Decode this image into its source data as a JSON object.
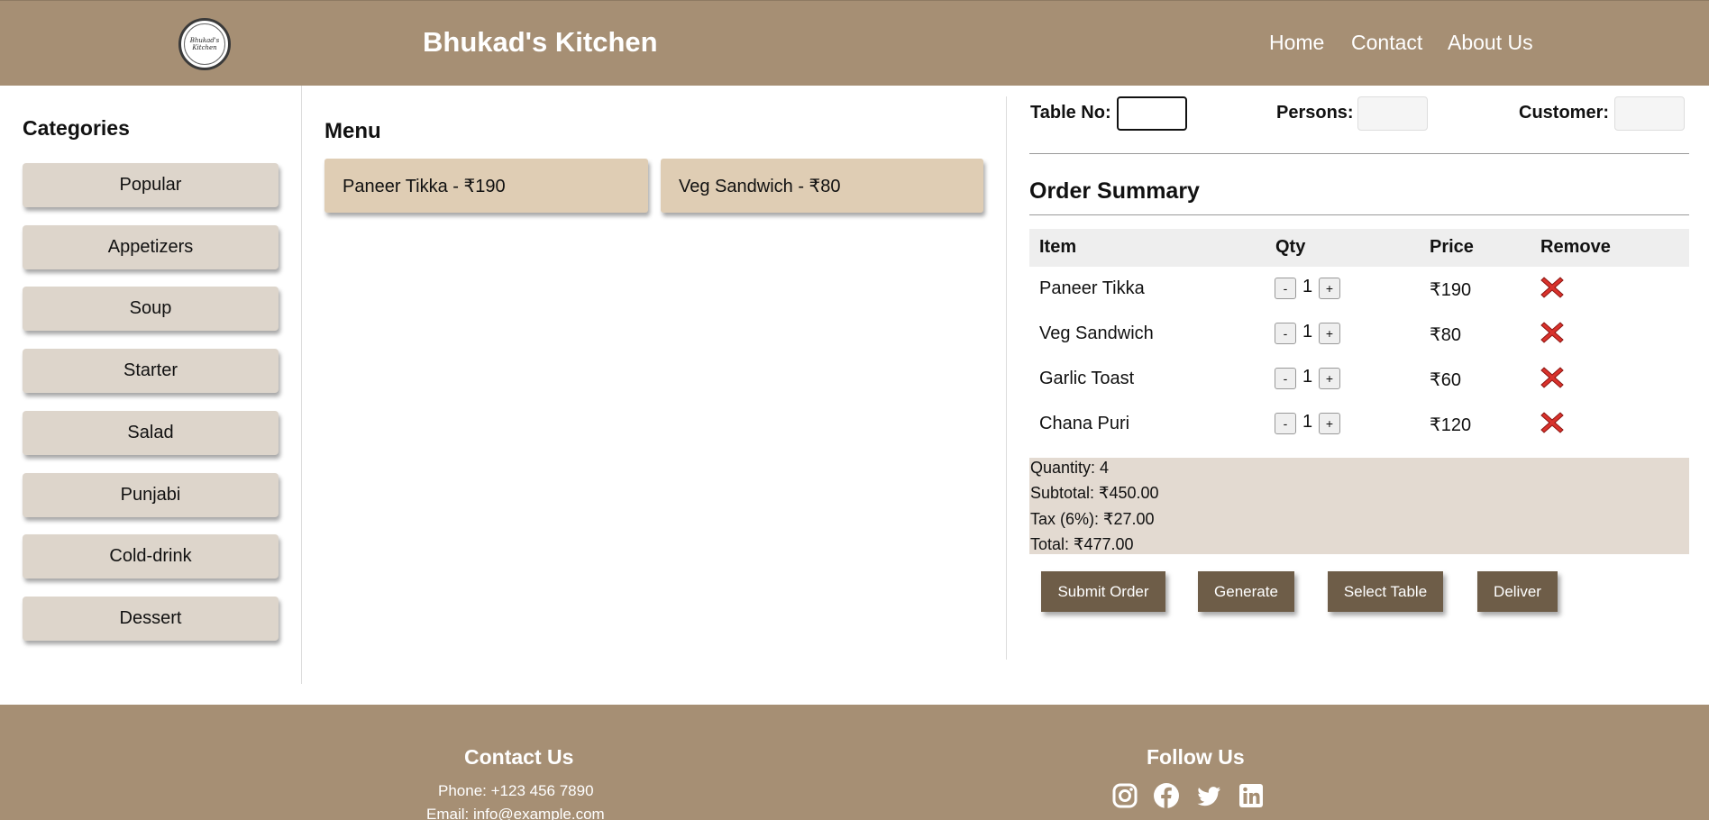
{
  "header": {
    "brand": "Bhukad's Kitchen",
    "logo_text": "Bhukad's Kitchen",
    "nav": [
      "Home",
      "Contact",
      "About Us"
    ]
  },
  "sidebar": {
    "title": "Categories",
    "categories": [
      "Popular",
      "Appetizers",
      "Soup",
      "Starter",
      "Salad",
      "Punjabi",
      "Cold-drink",
      "Dessert"
    ]
  },
  "menu": {
    "title": "Menu",
    "items": [
      "Paneer Tikka - ₹190",
      "Veg Sandwich - ₹80"
    ]
  },
  "order_form": {
    "table_label": "Table No:",
    "table_value": "",
    "persons_label": "Persons:",
    "persons_value": "",
    "customer_label": "Customer:",
    "customer_value": ""
  },
  "summary": {
    "title": "Order Summary",
    "headers": [
      "Item",
      "Qty",
      "Price",
      "Remove"
    ],
    "rows": [
      {
        "item": "Paneer Tikka",
        "qty": "1",
        "price": "₹190"
      },
      {
        "item": "Veg Sandwich",
        "qty": "1",
        "price": "₹80"
      },
      {
        "item": "Garlic Toast",
        "qty": "1",
        "price": "₹60"
      },
      {
        "item": "Chana Puri",
        "qty": "1",
        "price": "₹120"
      }
    ],
    "minus": "-",
    "plus": "+",
    "quantity": "Quantity: 4",
    "subtotal": "Subtotal: ₹450.00",
    "tax": "Tax (6%): ₹27.00",
    "total": "Total: ₹477.00"
  },
  "actions": [
    "Submit Order",
    "Generate",
    "Select Table",
    "Deliver"
  ],
  "footer": {
    "contact_title": "Contact Us",
    "phone": "Phone: +123 456 7890",
    "email": "Email: info@example.com",
    "follow_title": "Follow Us",
    "social_icons": [
      "instagram-icon",
      "facebook-icon",
      "twitter-icon",
      "linkedin-icon"
    ]
  },
  "colors": {
    "header_bg": "#a68f74",
    "category_btn": "#ddd5cb",
    "menu_card": "#dfcdb4",
    "totals_bg": "#e3dad1",
    "action_btn": "#6e5d48",
    "remove_icon": "#d9322c"
  }
}
